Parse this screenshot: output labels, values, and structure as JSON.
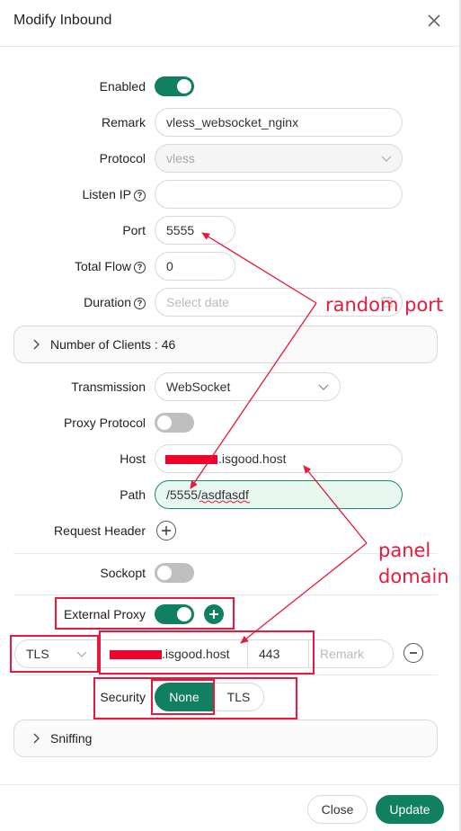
{
  "dialog": {
    "title": "Modify Inbound"
  },
  "form": {
    "enabled_label": "Enabled",
    "remark_label": "Remark",
    "remark_value": "vless_websocket_nginx",
    "protocol_label": "Protocol",
    "protocol_value": "vless",
    "listen_ip_label": "Listen IP",
    "listen_ip_value": "",
    "port_label": "Port",
    "port_value": "5555",
    "total_flow_label": "Total Flow",
    "total_flow_value": "0",
    "duration_label": "Duration",
    "duration_placeholder": "Select date",
    "clients_panel": "Number of Clients : 46",
    "transmission_label": "Transmission",
    "transmission_value": "WebSocket",
    "proxy_protocol_label": "Proxy Protocol",
    "host_label": "Host",
    "host_value": ".isgood.host",
    "path_label": "Path",
    "path_value": "/5555/asdfasdf",
    "request_header_label": "Request Header",
    "sockopt_label": "Sockopt",
    "external_proxy_label": "External Proxy",
    "ext_security_value": "TLS",
    "ext_host_value": ".isgood.host",
    "ext_port_value": "443",
    "ext_remark_placeholder": "Remark",
    "security_label": "Security",
    "security_options": [
      "None",
      "TLS"
    ],
    "sniffing_panel": "Sniffing"
  },
  "toggles": {
    "enabled": true,
    "proxy_protocol": false,
    "sockopt": false,
    "external_proxy": true
  },
  "annotations": {
    "random_port": "random port",
    "panel_domain_1": "panel",
    "panel_domain_2": "domain"
  },
  "footer": {
    "close_label": "Close",
    "update_label": "Update"
  },
  "colors": {
    "accent": "#118060",
    "annotation": "#e8193c"
  },
  "icons": [
    "close-icon",
    "help-icon",
    "chevron-down-icon",
    "chevron-right-icon",
    "calendar-icon",
    "plus-icon",
    "minus-icon"
  ]
}
